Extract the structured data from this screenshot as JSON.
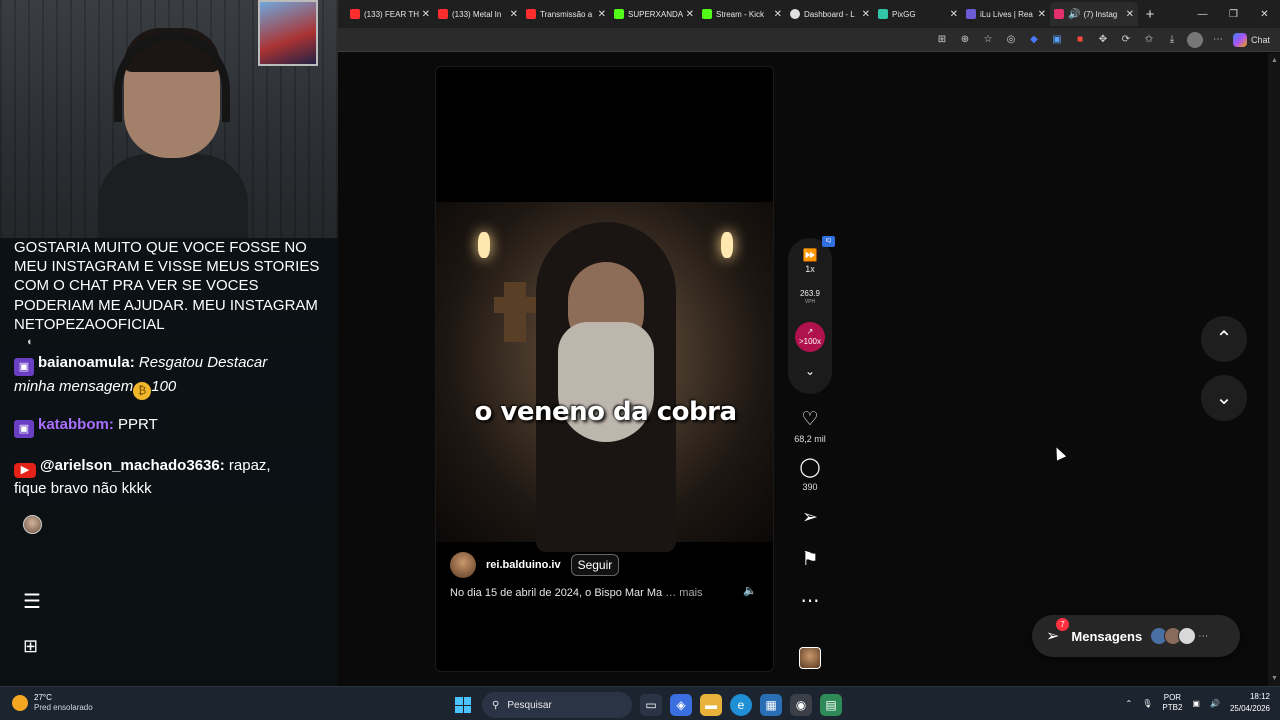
{
  "browser": {
    "tabs": [
      {
        "label": "(133) FEAR TH",
        "color": "#ff2d2d"
      },
      {
        "label": "(133) Metal In",
        "color": "#ff2d2d"
      },
      {
        "label": "Transmissão a",
        "color": "#ff2d2d"
      },
      {
        "label": "SUPERXANDA",
        "color": "#53fc18"
      },
      {
        "label": "Stream - Kick",
        "color": "#53fc18"
      },
      {
        "label": "Dashboard - L",
        "color": "#e0e0e0"
      },
      {
        "label": "PixGG",
        "color": "#32c5a8"
      },
      {
        "label": "iLu Lives | Rea",
        "color": "#6b5bd6"
      },
      {
        "label": "(7) Instag",
        "color": "#e1306c"
      }
    ],
    "new_tab": "+",
    "chat_label": "Chat"
  },
  "stream": {
    "highlight_message": "GOSTARIA MUITO QUE VOCE FOSSE NO MEU INSTAGRAM E VISSE MEUS STORIES COM O CHAT PRA VER SE VOCES PODERIAM ME AJUDAR. MEU INSTAGRAM NETOPEZAOOFICIAL",
    "messages": [
      {
        "user": "baianoamula:",
        "text": "Resgatou Destacar",
        "text2": "minha mensagem",
        "amount": "100",
        "user_color": "#ffffff",
        "platform": "twitch"
      },
      {
        "user": "katabbom:",
        "text": "PPRT",
        "user_color": "#a970ff",
        "platform": "twitch"
      },
      {
        "user": "@arielson_machado3636:",
        "text": "rapaz,",
        "text2": "fique bravo não kkkk",
        "user_color": "#ffffff",
        "platform": "youtube"
      }
    ]
  },
  "reel": {
    "overlay_caption": "o veneno da cobra",
    "author": "rei.balduino.iv",
    "follow_label": "Seguir",
    "description": "No dia 15 de abril de 2024, o Bispo Mar Ma",
    "more_label": "… mais",
    "speed": "1x",
    "vph_value": "263.9",
    "vph_label": "VPH",
    "trend_label": ">100x",
    "ext_badge": "IQ",
    "likes": "68,2 mil",
    "comments": "390"
  },
  "messages_bar": {
    "label": "Mensagens",
    "badge": "7"
  },
  "taskbar": {
    "temperature": "27°C",
    "weather": "Pred ensolarado",
    "search_placeholder": "Pesquisar",
    "lang_top": "POR",
    "lang_bottom": "PTB2",
    "time": "18:12",
    "date": "25/04/2026"
  }
}
